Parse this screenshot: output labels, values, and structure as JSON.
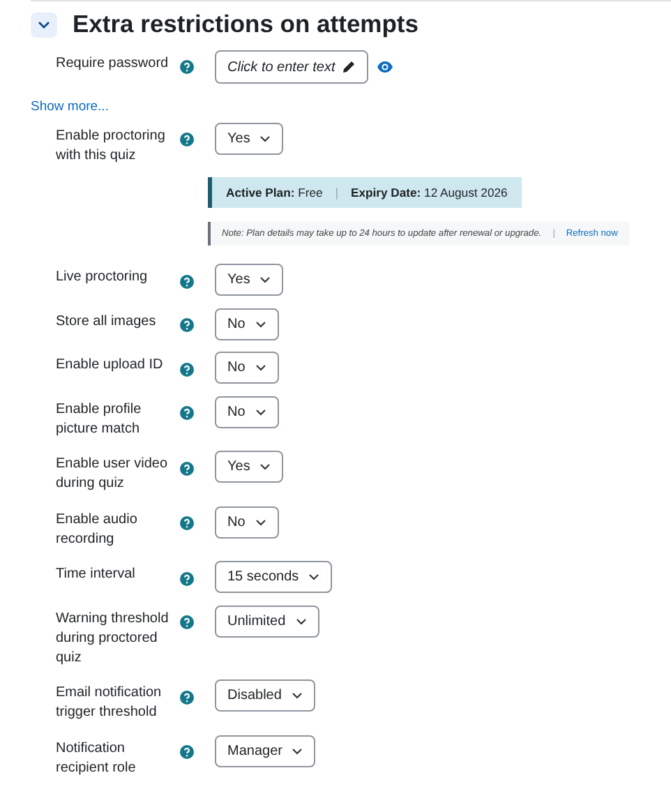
{
  "section": {
    "title": "Extra restrictions on attempts",
    "expanded": true
  },
  "rows": [
    {
      "kind": "password",
      "label": "Require password",
      "text": "Click to enter text"
    },
    {
      "kind": "link",
      "text": "Show more..."
    },
    {
      "kind": "select",
      "label": "Enable proctoring with this quiz",
      "value": "Yes"
    },
    {
      "kind": "plan",
      "parts": [
        "**Active Plan:** Free",
        "|",
        "**Expiry Date:** 12 August 2026"
      ]
    },
    {
      "kind": "note",
      "text": "Note: Plan details may take up to 24 hours to update after renewal or upgrade.",
      "separator": "|",
      "link": "Refresh now"
    },
    {
      "kind": "select",
      "label": "Live proctoring",
      "value": "Yes"
    },
    {
      "kind": "select",
      "label": "Store all images",
      "value": "No"
    },
    {
      "kind": "select",
      "label": "Enable upload ID",
      "value": "No"
    },
    {
      "kind": "select",
      "label": "Enable profile picture match",
      "value": "No"
    },
    {
      "kind": "select",
      "label": "Enable user video during quiz",
      "value": "Yes"
    },
    {
      "kind": "select",
      "label": "Enable audio recording",
      "value": "No"
    },
    {
      "kind": "select",
      "label": "Time interval",
      "value": "15 seconds"
    },
    {
      "kind": "select",
      "label": "Warning threshold during proctored quiz",
      "value": "Unlimited"
    },
    {
      "kind": "select",
      "label": "Email notification trigger threshold",
      "value": "Disabled"
    },
    {
      "kind": "select",
      "label": "Notification recipient role",
      "value": "Manager"
    }
  ]
}
